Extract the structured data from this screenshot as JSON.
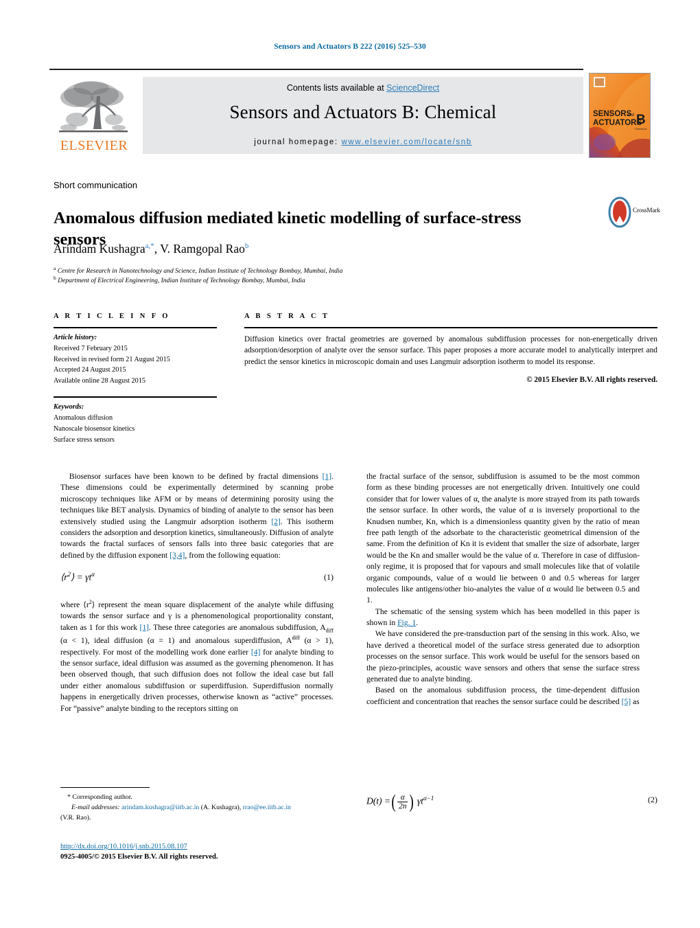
{
  "running_head": "Sensors and Actuators B 222 (2016) 525–530",
  "masthead": {
    "contents_text": "Contents lists available at ",
    "sciencedirect": "ScienceDirect",
    "journal_title": "Sensors and Actuators B: Chemical",
    "homepage_label": "journal homepage: ",
    "homepage_url": "www.elsevier.com/locate/snb",
    "publisher_wordmark": "ELSEVIER",
    "cover_line1": "SENSORS",
    "cover_and": "and",
    "cover_line2": "ACTUATORS",
    "cover_letter": "B",
    "cover_sub": "Chemical"
  },
  "article": {
    "kind": "Short communication",
    "title": "Anomalous diffusion mediated kinetic modelling of surface-stress sensors",
    "authors_part1": "Arindam Kushagra",
    "authors_sup1": "a,",
    "authors_star": "*",
    "authors_part2": ", V. Ramgopal Rao",
    "authors_sup2": "b",
    "affiliation_a_marker": "a",
    "affiliation_a": " Centre for Research in Nanotechnology and Science, Indian Institute of Technology Bombay, Mumbai, India",
    "affiliation_b_marker": "b",
    "affiliation_b": " Department of Electrical Engineering, Indian Institute of Technology Bombay, Mumbai, India",
    "crossmark_label": "CrossMark"
  },
  "info": {
    "heading": "A R T I C L E    I N F O",
    "history_label": "Article history:",
    "history": [
      "Received 7 February 2015",
      "Received in revised form 21 August 2015",
      "Accepted 24 August 2015",
      "Available online 28 August 2015"
    ],
    "keywords_label": "Keywords:",
    "keywords": [
      "Anomalous diffusion",
      "Nanoscale biosensor kinetics",
      "Surface stress sensors"
    ]
  },
  "abstract": {
    "heading": "A B S T R A C T",
    "text": "Diffusion kinetics over fractal geometries are governed by anomalous subdiffusion processes for non-energetically driven adsorption/desorption of analyte over the sensor surface. This paper proposes a more accurate model to analytically interpret and predict the sensor kinetics in microscopic domain and uses Langmuir adsorption isotherm to model its response.",
    "copyright": "© 2015 Elsevier B.V. All rights reserved."
  },
  "body": {
    "left": {
      "p1_a": "Biosensor surfaces have been known to be defined by fractal dimensions ",
      "p1_r1": "[1]",
      "p1_b": ". These dimensions could be experimentally determined by scanning probe microscopy techniques like AFM or by means of determining porosity using the techniques like BET analysis. Dynamics of binding of analyte to the sensor has been extensively studied using the Langmuir adsorption isotherm ",
      "p1_r2": "[2]",
      "p1_c": ". This isotherm considers the adsorption and desorption kinetics, simultaneously. Diffusion of analyte towards the fractal surfaces of sensors falls into three basic categories that are defined by the diffusion exponent ",
      "p1_r3": "[3,4]",
      "p1_d": ", from the following equation:",
      "eq1_lhs": "⟨r",
      "eq1_sup": "2",
      "eq1_rhs": "⟩ = γt",
      "eq1_alpha": "α",
      "eq1_num": "(1)",
      "p2_a": "where ⟨r",
      "p2_sup": "2",
      "p2_b": "⟩ represent the mean square displacement of the analyte while diffusing towards the sensor surface and γ is a phenomenological proportionality constant, taken as 1 for this work ",
      "p2_r1": "[1]",
      "p2_c": ". These three categories are anomalous subdiffusion, A",
      "p2_sub1": "diff",
      "p2_d": " (α < 1), ideal diffusion (α = 1) and anomalous superdiffusion, A",
      "p2_sup2": "diff",
      "p2_e": " (α > 1), respectively. For most of the modelling work done earlier ",
      "p2_r2": "[4]",
      "p2_f": " for analyte binding to the sensor surface, ideal diffusion was assumed as the governing phenomenon. It has been observed though, that such diffusion does not follow the ideal case but fall under either anomalous subdiffusion or superdiffusion. Superdiffusion normally happens in energetically driven processes, otherwise known as “active” processes. For “passive” analyte binding to the receptors sitting on"
    },
    "right": {
      "p1": "the fractal surface of the sensor, subdiffusion is assumed to be the most common form as these binding processes are not energetically driven. Intuitively one could consider that for lower values of α, the analyte is more strayed from its path towards the sensor surface. In other words, the value of α is inversely proportional to the Knudsen number, Kn, which is a dimensionless quantity given by the ratio of mean free path length of the adsorbate to the characteristic geometrical dimension of the same. From the definition of Kn it is evident that smaller the size of adsorbate, larger would be the Kn and smaller would be the value of α. Therefore in case of diffusion-only regime, it is proposed that for vapours and small molecules like that of volatile organic compounds, value of α would lie between 0 and 0.5 whereas for larger molecules like antigens/other bio-analytes the value of α would lie between 0.5 and 1.",
      "p2_a": "The schematic of the sensing system which has been modelled in this paper is shown in ",
      "p2_fig": "Fig. 1",
      "p2_b": ".",
      "p3": "We have considered the pre-transduction part of the sensing in this work. Also, we have derived a theoretical model of the surface stress generated due to adsorption processes on the sensor surface. This work would be useful for the sensors based on the piezo-principles, acoustic wave sensors and others that sense the surface stress generated due to analyte binding.",
      "p4_a": "Based on the anomalous subdiffusion process, the time-dependent diffusion coefficient and concentration that reaches the sensor surface could be described ",
      "p4_r": "[5]",
      "p4_b": " as",
      "eq2_lhs": "D(t) =",
      "eq2_num_top": "α",
      "eq2_num_bot": "2n",
      "eq2_rhs": "γt",
      "eq2_exp": "α−1",
      "eq2_num": "(2)"
    }
  },
  "footnotes": {
    "corresponding": "* Corresponding author.",
    "email_label": "E-mail addresses:",
    "email1": "arindam.kushagra@iitb.ac.in",
    "email1_name": " (A. Kushagra), ",
    "email2": "rrao@ee.iitb.ac.in",
    "email2_name": "(V.R. Rao).",
    "doi": "http://dx.doi.org/10.1016/j.snb.2015.08.107",
    "issn": "0925-4005/© 2015 Elsevier B.V. All rights reserved."
  },
  "colors": {
    "link": "#0a6aa1",
    "sciencedirect": "#2b7bb9",
    "elsevier_orange": "#e87722"
  }
}
